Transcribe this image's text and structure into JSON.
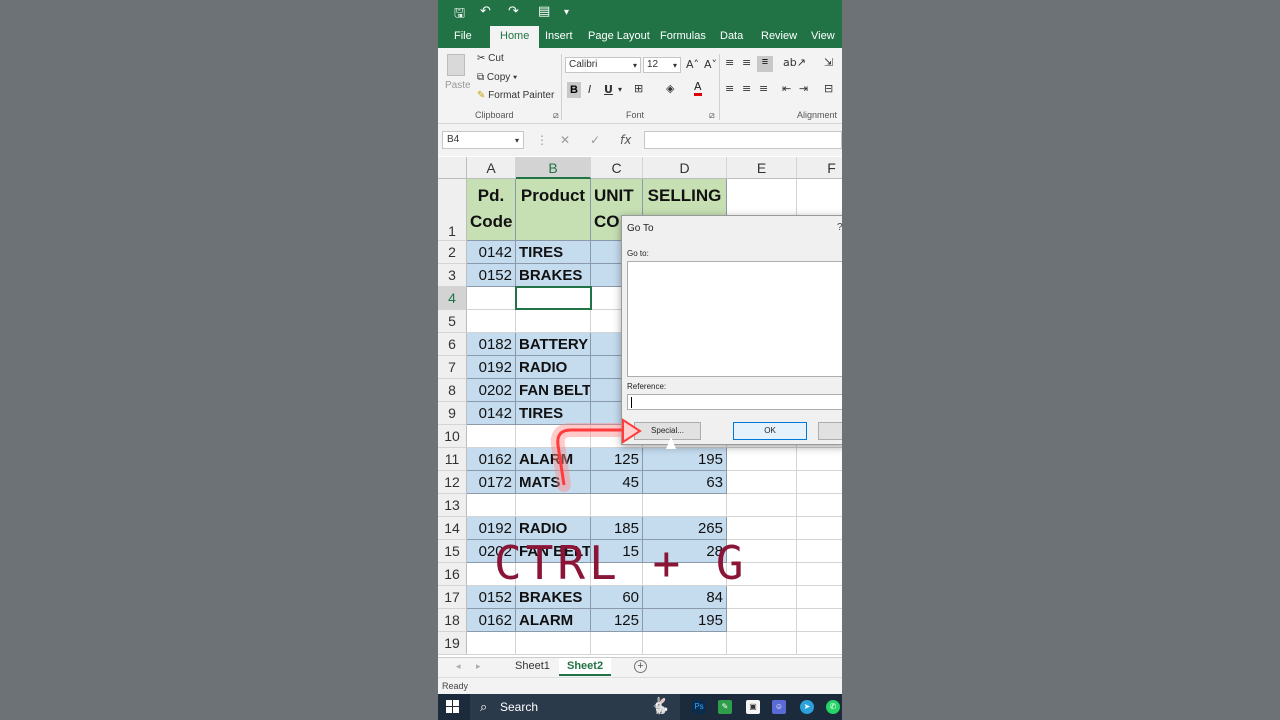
{
  "qat": {
    "save_icon": "save-icon",
    "undo_icon": "undo-icon",
    "redo_icon": "redo-icon",
    "form_icon": "form-icon",
    "more": "⋮"
  },
  "tabs": [
    "File",
    "Home",
    "Insert",
    "Page Layout",
    "Formulas",
    "Data",
    "Review",
    "View"
  ],
  "ribbon": {
    "paste": "Paste",
    "cut": "Cut",
    "copy": "Copy",
    "format_painter": "Format Painter",
    "clipboard": "Clipboard",
    "font_name": "Calibri",
    "font_size": "12",
    "bold": "B",
    "italic": "I",
    "underline": "U",
    "font_group": "Font",
    "alignment_group": "Alignment"
  },
  "formula_bar": {
    "name_box": "B4",
    "fx": "fx",
    "cancel": "✕",
    "enter": "✓"
  },
  "columns": [
    "A",
    "B",
    "C",
    "D",
    "E",
    "F"
  ],
  "header_row": {
    "a": "Pd. Code",
    "b": "Product",
    "c": "UNIT CO",
    "d": "SELLING"
  },
  "rows": [
    {
      "n": "1"
    },
    {
      "n": "2",
      "a": "0142",
      "b": "TIRES",
      "c": "",
      "d": ""
    },
    {
      "n": "3",
      "a": "0152",
      "b": "BRAKES",
      "c": "",
      "d": ""
    },
    {
      "n": "4",
      "a": "",
      "b": "",
      "c": "",
      "d": ""
    },
    {
      "n": "5",
      "a": "",
      "b": "",
      "c": "",
      "d": ""
    },
    {
      "n": "6",
      "a": "0182",
      "b": "BATTERY",
      "c": "",
      "d": ""
    },
    {
      "n": "7",
      "a": "0192",
      "b": "RADIO",
      "c": "1",
      "d": ""
    },
    {
      "n": "8",
      "a": "0202",
      "b": "FAN BELT",
      "c": "",
      "d": ""
    },
    {
      "n": "9",
      "a": "0142",
      "b": "TIRES",
      "c": "",
      "d": ""
    },
    {
      "n": "10",
      "a": "",
      "b": "",
      "c": "",
      "d": ""
    },
    {
      "n": "11",
      "a": "0162",
      "b": "ALARM",
      "c": "125",
      "d": "195"
    },
    {
      "n": "12",
      "a": "0172",
      "b": "MATS",
      "c": "45",
      "d": "63"
    },
    {
      "n": "13",
      "a": "",
      "b": "",
      "c": "",
      "d": ""
    },
    {
      "n": "14",
      "a": "0192",
      "b": "RADIO",
      "c": "185",
      "d": "265"
    },
    {
      "n": "15",
      "a": "0202",
      "b": "FAN BELT",
      "c": "15",
      "d": "28"
    },
    {
      "n": "16",
      "a": "",
      "b": "",
      "c": "",
      "d": ""
    },
    {
      "n": "17",
      "a": "0152",
      "b": "BRAKES",
      "c": "60",
      "d": "84"
    },
    {
      "n": "18",
      "a": "0162",
      "b": "ALARM",
      "c": "125",
      "d": "195"
    },
    {
      "n": "19",
      "a": "",
      "b": "",
      "c": "",
      "d": ""
    }
  ],
  "sheets": [
    "Sheet1",
    "Sheet2"
  ],
  "status": "Ready",
  "taskbar": {
    "search": "Search"
  },
  "dialog": {
    "title": "Go To",
    "help": "?",
    "goto_label": "Go to:",
    "reference_label": "Reference:",
    "special": "Special...",
    "ok": "OK"
  },
  "overlay": {
    "shortcut": "CTRL + G"
  },
  "colors": {
    "excel_green": "#217346",
    "row_blue": "#c5dcef",
    "header_green": "#c6e0b4",
    "overlay_text": "#8a1537",
    "arrow_red": "#ff3b3b"
  }
}
